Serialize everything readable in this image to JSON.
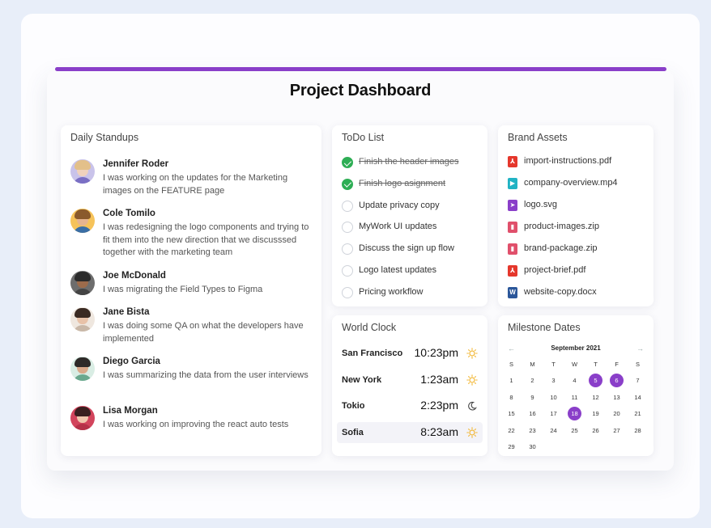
{
  "title": "Project Dashboard",
  "colors": {
    "accent": "#8a3fc9",
    "done": "#2eae55"
  },
  "standups": {
    "title": "Daily Standups",
    "people": [
      {
        "name": "Jennifer Roder",
        "message": "I was working on the updates for the Marketing images on the FEATURE page",
        "avatar": "avatar-jennifer"
      },
      {
        "name": "Cole Tomilo",
        "message": "I was redesigning the logo components and trying to fit them into the new direction that we discusssed together with the marketing team",
        "avatar": "avatar-cole"
      },
      {
        "name": "Joe McDonald",
        "message": "I was migrating the Field Types to Figma",
        "avatar": "avatar-joe"
      },
      {
        "name": "Jane Bista",
        "message": "I was doing some QA on what the developers have implemented",
        "avatar": "avatar-jane"
      },
      {
        "name": "Diego Garcia",
        "message": "I was summarizing the data from the user interviews",
        "avatar": "avatar-diego"
      },
      {
        "name": "Lisa Morgan",
        "message": "I was working on improving the react auto tests",
        "avatar": "avatar-lisa"
      }
    ]
  },
  "todo": {
    "title": "ToDo List",
    "items": [
      {
        "label": "Finish the header images",
        "done": true
      },
      {
        "label": "Finish logo asignment",
        "done": true
      },
      {
        "label": "Update privacy copy",
        "done": false
      },
      {
        "label": "MyWork UI updates",
        "done": false
      },
      {
        "label": "Discuss the sign up flow",
        "done": false
      },
      {
        "label": "Logo latest updates",
        "done": false
      },
      {
        "label": "Pricing workflow",
        "done": false
      }
    ]
  },
  "assets": {
    "title": "Brand Assets",
    "files": [
      {
        "name": "import-instructions.pdf",
        "icon": "pdf-icon",
        "color": "#e5372c"
      },
      {
        "name": "company-overview.mp4",
        "icon": "video-icon",
        "color": "#21b3c4"
      },
      {
        "name": "logo.svg",
        "icon": "svg-icon",
        "color": "#8a3fc9"
      },
      {
        "name": "product-images.zip",
        "icon": "zip-icon",
        "color": "#e0506b"
      },
      {
        "name": "brand-package.zip",
        "icon": "zip-icon",
        "color": "#e0506b"
      },
      {
        "name": "project-brief.pdf",
        "icon": "pdf-icon",
        "color": "#e5372c"
      },
      {
        "name": "website-copy.docx",
        "icon": "docx-icon",
        "color": "#2b579a"
      }
    ]
  },
  "clock": {
    "title": "World Clock",
    "cities": [
      {
        "city": "San Francisco",
        "time": "10:23pm",
        "icon": "sun-icon"
      },
      {
        "city": "New York",
        "time": "1:23am",
        "icon": "sun-icon"
      },
      {
        "city": "Tokio",
        "time": "2:23pm",
        "icon": "moon-icon"
      },
      {
        "city": "Sofia",
        "time": "8:23am",
        "icon": "sun-icon",
        "highlighted": true
      }
    ]
  },
  "calendar": {
    "title": "Milestone Dates",
    "month": "September 2021",
    "prev": "←",
    "next": "→",
    "weekdays": [
      "S",
      "M",
      "T",
      "W",
      "T",
      "F",
      "S"
    ],
    "weeks": [
      [
        "",
        "",
        "",
        "",
        "",
        "",
        ""
      ],
      [
        "1",
        "2",
        "3",
        "4",
        "5",
        "6",
        "7"
      ],
      [
        "8",
        "9",
        "10",
        "11",
        "12",
        "13",
        "14"
      ],
      [
        "15",
        "16",
        "17",
        "18",
        "19",
        "20",
        "21"
      ],
      [
        "22",
        "23",
        "24",
        "25",
        "26",
        "27",
        "28"
      ],
      [
        "29",
        "30",
        "",
        "",
        "",
        "",
        ""
      ]
    ],
    "selected": [
      "5",
      "6",
      "18"
    ]
  }
}
